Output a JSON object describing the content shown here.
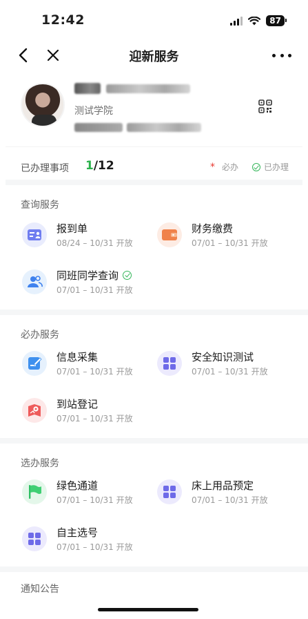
{
  "status_bar": {
    "time": "12:42",
    "battery": "87"
  },
  "nav": {
    "title": "迎新服务",
    "back_icon": "chevron-left-icon",
    "close_icon": "close-icon",
    "more_icon": "more-icon"
  },
  "profile": {
    "college": "测试学院"
  },
  "progress": {
    "label": "已办理事项",
    "done": "1",
    "total": "/12",
    "required_label": "必办",
    "done_label": "已办理"
  },
  "sections": {
    "query": {
      "title": "查询服务",
      "items": [
        {
          "name": "报到单",
          "date": "08/24 – 10/31 开放",
          "icon": "report-card-icon"
        },
        {
          "name": "财务缴费",
          "date": "07/01 – 10/31 开放",
          "icon": "wallet-icon"
        },
        {
          "name": "同班同学查询",
          "date": "07/01 – 10/31 开放",
          "icon": "classmates-icon"
        }
      ]
    },
    "required": {
      "title": "必办服务",
      "items": [
        {
          "name": "信息采集",
          "date": "07/01 – 10/31 开放",
          "icon": "edit-form-icon"
        },
        {
          "name": "安全知识测试",
          "date": "07/01 – 10/31 开放",
          "icon": "grid-icon"
        },
        {
          "name": "到站登记",
          "date": "07/01 – 10/31 开放",
          "icon": "map-pin-icon"
        }
      ]
    },
    "optional": {
      "title": "选办服务",
      "items": [
        {
          "name": "绿色通道",
          "date": "07/01 – 10/31 开放",
          "icon": "flag-icon"
        },
        {
          "name": "床上用品预定",
          "date": "07/01 – 10/31 开放",
          "icon": "grid-icon"
        },
        {
          "name": "自主选号",
          "date": "07/01 – 10/31 开放",
          "icon": "grid-icon"
        }
      ]
    },
    "notice": {
      "title": "通知公告"
    }
  }
}
